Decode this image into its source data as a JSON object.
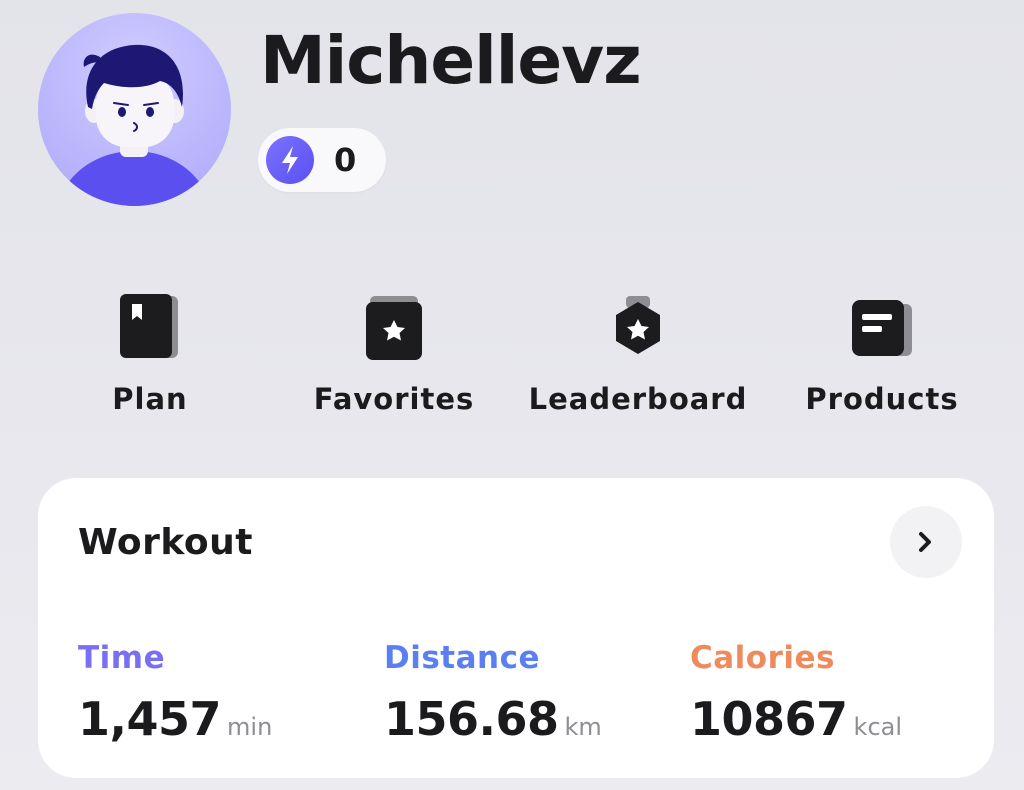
{
  "profile": {
    "username": "Michellevz",
    "avatar_icon": "user-avatar-icon",
    "energy_icon": "lightning-bolt-icon",
    "energy_count": "0"
  },
  "nav": [
    {
      "label": "Plan",
      "icon": "bookmark-book-icon"
    },
    {
      "label": "Favorites",
      "icon": "star-folder-icon"
    },
    {
      "label": "Leaderboard",
      "icon": "medal-icon"
    },
    {
      "label": "Products",
      "icon": "document-list-icon"
    }
  ],
  "workout": {
    "title": "Workout",
    "arrow_icon": "chevron-right-icon",
    "stats": [
      {
        "label": "Time",
        "value": "1,457",
        "unit": "min",
        "color": "#7a6ff2"
      },
      {
        "label": "Distance",
        "value": "156.68",
        "unit": "km",
        "color": "#5b7ff0"
      },
      {
        "label": "Calories",
        "value": "10867",
        "unit": "kcal",
        "color": "#ef8a5d"
      }
    ]
  },
  "colors": {
    "accent": "#5a4ff0",
    "background": "#e6e6ec",
    "card": "#ffffff"
  }
}
